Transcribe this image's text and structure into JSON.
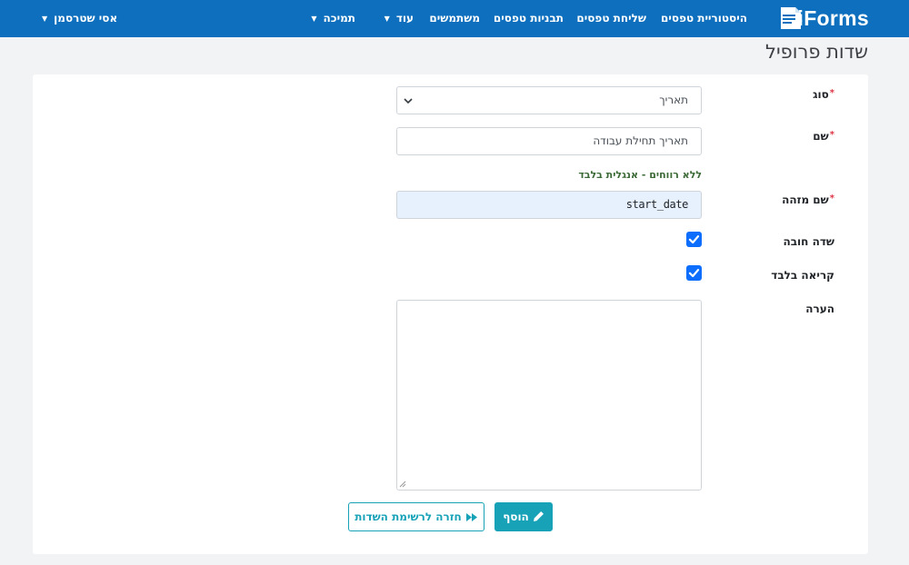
{
  "app": {
    "brand": "iForms"
  },
  "nav": {
    "items": [
      {
        "label": "היסטוריית טפסים"
      },
      {
        "label": "שליחת טפסים"
      },
      {
        "label": "תבניות טפסים"
      },
      {
        "label": "משתמשים"
      },
      {
        "label": "עוד"
      },
      {
        "label": "תמיכה"
      }
    ],
    "user": "אסי שטרסמן"
  },
  "page": {
    "title": "שדות פרופיל"
  },
  "form": {
    "type_label": "סוג",
    "type_value": "תאריך",
    "name_label": "שם",
    "name_value": "תאריך תחילת עבודה",
    "id_hint": "ללא רווחים - אנגלית בלבד",
    "id_label": "שם מזהה",
    "id_value": "start_date",
    "required_label": "שדה חובה",
    "required_checked": true,
    "readonly_label": "קריאה בלבד",
    "readonly_checked": true,
    "note_label": "הערה",
    "note_value": "",
    "required_marker": "*"
  },
  "actions": {
    "add_label": "הוסף",
    "back_label": "חזרה לרשימת השדות"
  },
  "colors": {
    "navbar": "#0d6fbd",
    "accent": "#17a2b8",
    "checkbox": "#0d6efd",
    "required": "#dc3545",
    "hint": "#3d6b38"
  }
}
